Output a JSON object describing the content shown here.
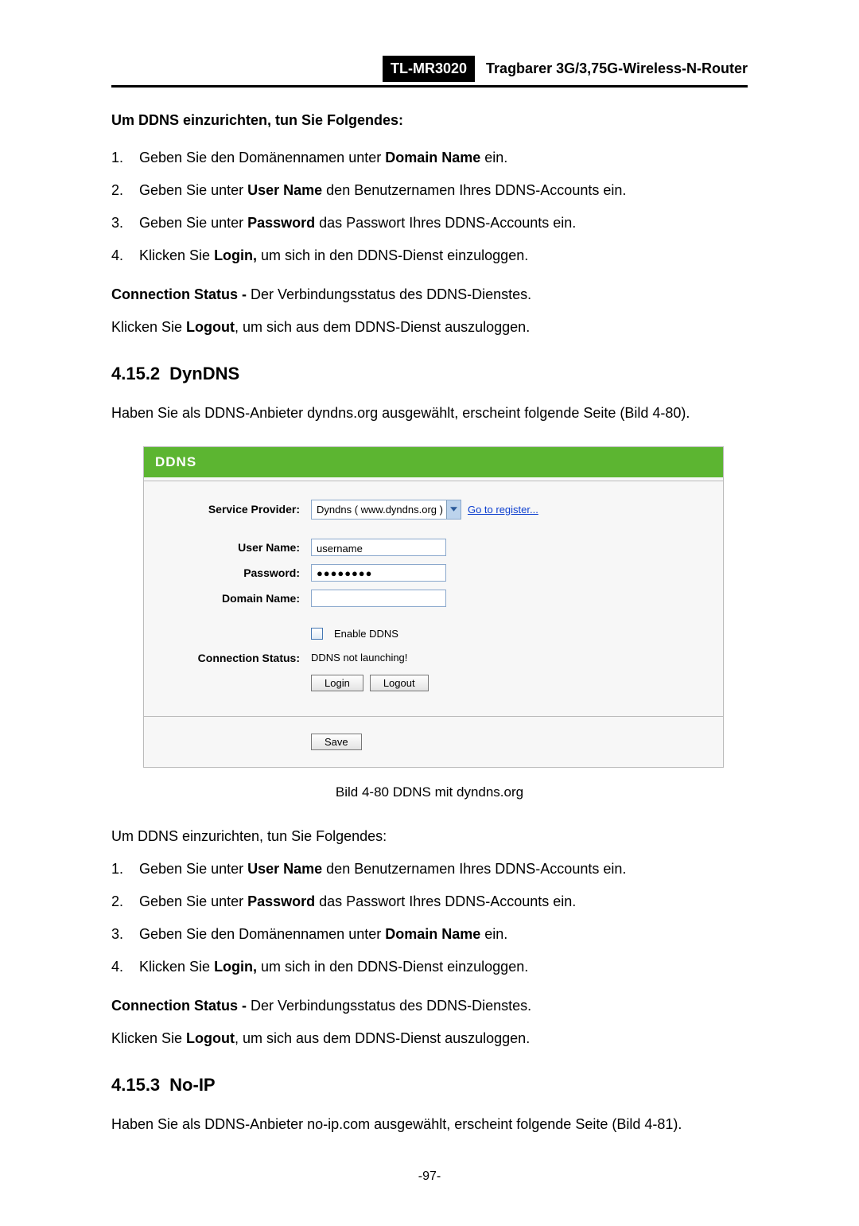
{
  "header": {
    "model": "TL-MR3020",
    "desc": "Tragbarer 3G/3,75G-Wireless-N-Router"
  },
  "intro1": "Um DDNS einzurichten, tun Sie Folgendes:",
  "list1": [
    {
      "n": "1.",
      "pre": "Geben Sie den Domänennamen unter ",
      "bold": "Domain Name",
      "post": " ein."
    },
    {
      "n": "2.",
      "pre": "Geben Sie unter ",
      "bold": "User Name",
      "post": " den Benutzernamen Ihres DDNS-Accounts ein."
    },
    {
      "n": "3.",
      "pre": "Geben Sie unter ",
      "bold": "Password",
      "post": " das Passwort Ihres DDNS-Accounts ein."
    },
    {
      "n": "4.",
      "pre": "Klicken Sie ",
      "bold": "Login,",
      "post": " um sich in den DDNS-Dienst einzuloggen."
    }
  ],
  "conn1": {
    "bold": "Connection Status - ",
    "text": "Der Verbindungsstatus des DDNS-Dienstes."
  },
  "logout1": {
    "pre": "Klicken Sie ",
    "bold": "Logout",
    "post": ", um sich aus dem DDNS-Dienst auszuloggen."
  },
  "sec_dyndns": {
    "num": "4.15.2",
    "title": "DynDNS"
  },
  "dyndns_intro": "Haben Sie als DDNS-Anbieter dyndns.org ausgewählt, erscheint folgende Seite (Bild 4-80).",
  "ui": {
    "title": "DDNS",
    "labels": {
      "service_provider": "Service Provider:",
      "user_name": "User Name:",
      "password": "Password:",
      "domain_name": "Domain Name:",
      "connection_status": "Connection Status:"
    },
    "provider_value": "Dyndns ( www.dyndns.org )",
    "register_link": "Go to register...",
    "username_value": "username",
    "password_value": "●●●●●●●●",
    "domain_value": "",
    "enable_label": "Enable DDNS",
    "status_value": "DDNS not launching!",
    "login_btn": "Login",
    "logout_btn": "Logout",
    "save_btn": "Save"
  },
  "caption": "Bild 4-80 DDNS mit dyndns.org",
  "intro2": "Um DDNS einzurichten, tun Sie Folgendes:",
  "list2": [
    {
      "n": "1.",
      "pre": "Geben Sie unter ",
      "bold": "User Name",
      "post": " den Benutzernamen Ihres DDNS-Accounts ein."
    },
    {
      "n": "2.",
      "pre": "Geben Sie unter ",
      "bold": "Password",
      "post": " das Passwort Ihres DDNS-Accounts ein."
    },
    {
      "n": "3.",
      "pre": "Geben Sie den Domänennamen unter ",
      "bold": "Domain Name",
      "post": " ein."
    },
    {
      "n": "4.",
      "pre": "Klicken Sie ",
      "bold": "Login,",
      "post": " um sich in den DDNS-Dienst einzuloggen."
    }
  ],
  "conn2": {
    "bold": "Connection Status - ",
    "text": "Der Verbindungsstatus des DDNS-Dienstes."
  },
  "logout2": {
    "pre": "Klicken Sie ",
    "bold": "Logout",
    "post": ", um sich aus dem DDNS-Dienst auszuloggen."
  },
  "sec_noip": {
    "num": "4.15.3",
    "title": "No-IP"
  },
  "noip_intro": "Haben Sie als DDNS-Anbieter no-ip.com ausgewählt, erscheint folgende Seite (Bild 4-81).",
  "page_number": "-97-"
}
